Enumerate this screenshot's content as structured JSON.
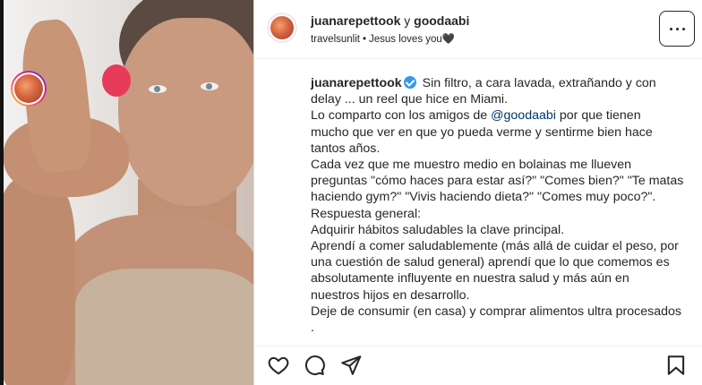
{
  "header": {
    "user1": "juanarepettook",
    "connector": "y",
    "user2": "goodaabi",
    "audio": "travelsunlit",
    "song": "Jesus loves you🖤"
  },
  "caption": {
    "username": "juanarepettook",
    "lines": [
      "Sin filtro, a cara lavada, extrañando y con",
      "delay ... un reel que hice en Miami.",
      "Lo comparto con los amigos de",
      "mucho que ver en que yo pueda verme y sentirme bien hace",
      "tantos años.",
      "Cada vez que me muestro medio en bolainas me llueven",
      "preguntas \"cómo haces para estar así?\" \"Comes bien?\" \"Te matas",
      "haciendo gym?\" \"Vivis haciendo dieta?\" \"Comes muy poco?\".",
      "Respuesta general:",
      "Adquirir hábitos saludables la clave principal.",
      "Aprendí a comer saludablemente (más allá de cuidar el peso, por",
      "una cuestión de salud general) aprendí que lo que comemos es",
      "absolutamente influyente en nuestra salud y más aún en",
      "nuestros hijos en desarrollo.",
      "Deje de consumir (en casa) y comprar alimentos ultra procesados",
      "."
    ],
    "mention": "@goodaabi",
    "mention_suffix": "por que tienen"
  },
  "icons": {
    "more": "more-options-icon",
    "like": "heart-icon",
    "comment": "comment-icon",
    "share": "send-icon",
    "save": "bookmark-icon"
  },
  "colors": {
    "verified": "#3897f0",
    "mention": "#00376b",
    "text": "#262626"
  }
}
